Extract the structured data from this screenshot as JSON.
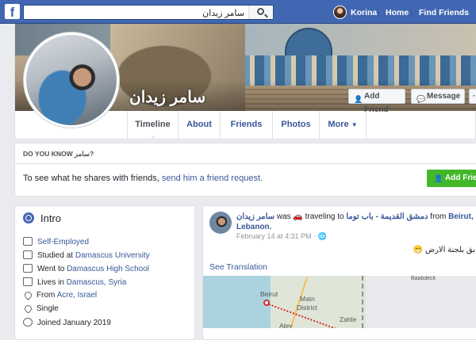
{
  "topbar": {
    "search_value": "سامر زيدان",
    "user_name": "Korina",
    "home_label": "Home",
    "find_friends_label": "Find Friends"
  },
  "profile": {
    "name": "سامر زيدان",
    "add_friend_label": "Add Friend",
    "message_label": "Message",
    "more_dots": "···",
    "tabs": [
      {
        "label": "Timeline",
        "active": true
      },
      {
        "label": "About"
      },
      {
        "label": "Friends"
      },
      {
        "label": "Photos"
      },
      {
        "label": "More"
      }
    ]
  },
  "do_you_know": {
    "title_prefix": "DO YOU KNOW ",
    "title_name": "سامر",
    "title_suffix": "?",
    "text": "To see what he shares with friends, ",
    "link": "send him a friend request.",
    "button_label": "Add Friend"
  },
  "intro": {
    "title": "Intro",
    "rows": [
      {
        "icon": "briefcase-icon",
        "link": "Self-Employed"
      },
      {
        "icon": "graduation-cap-icon",
        "text": "Studied at ",
        "link": "Damascus University"
      },
      {
        "icon": "graduation-cap-icon",
        "text": "Went to ",
        "link": "Damascus High School"
      },
      {
        "icon": "house-icon",
        "text": "Lives in ",
        "link": "Damascus, Syria"
      },
      {
        "icon": "location-pin-icon",
        "text": "From ",
        "link": "Acre, Israel"
      },
      {
        "icon": "heart-icon",
        "text": "Single"
      },
      {
        "icon": "clock-icon",
        "text": "Joined January 2019"
      }
    ]
  },
  "post": {
    "author": "سامر زيدان",
    "was": " was ",
    "activity": "traveling to",
    "from_place": "دمشق القديمة - باب توما",
    "from_word": " from ",
    "to_place": "Beirut,",
    "to_place_2": "Lebanon.",
    "date": "February 14 at 4:31 PM",
    "body": "بق بلجنة الارض 😁",
    "see_translation": "See Translation",
    "map_labels": {
      "beirut": "Beirut",
      "matn": "Matn",
      "district": "District",
      "baabdeck": "Baabdeck",
      "zahle": "Zahle",
      "aley": "Aley"
    }
  }
}
